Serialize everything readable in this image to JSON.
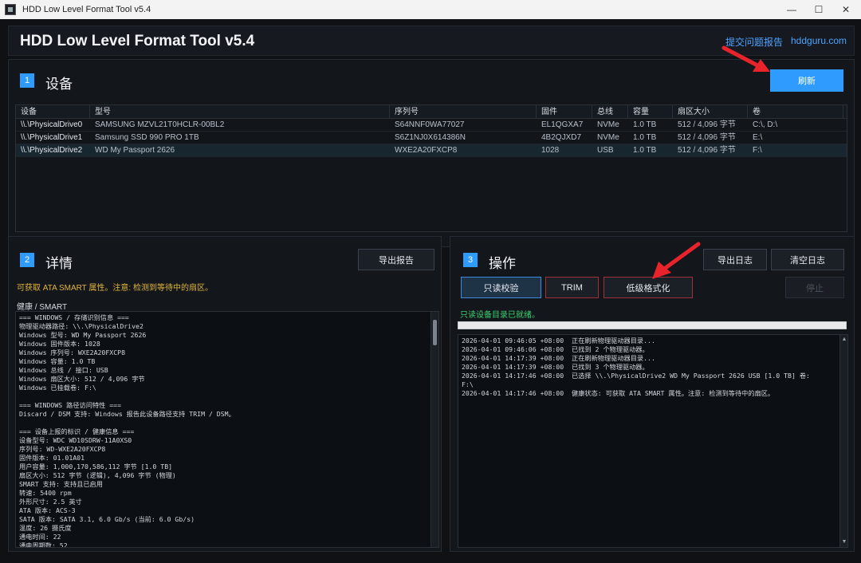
{
  "window": {
    "title": "HDD Low Level Format Tool v5.4",
    "controls": [
      "—",
      "☐",
      "✕"
    ]
  },
  "header": {
    "app_title": "HDD Low Level Format Tool v5.4",
    "links": [
      "提交问题报告",
      "hddguru.com"
    ]
  },
  "devices": {
    "step": "1",
    "title": "设备",
    "refresh_label": "刷新",
    "columns": [
      "设备",
      "型号",
      "序列号",
      "固件",
      "总线",
      "容量",
      "扇区大小",
      "卷"
    ],
    "rows": [
      [
        "\\\\.\\PhysicalDrive0",
        "SAMSUNG MZVL21T0HCLR-00BL2",
        "S64NNF0WA77027",
        "EL1QGXA7",
        "NVMe",
        "1.0 TB",
        "512 / 4,096 字节",
        "C:\\, D:\\"
      ],
      [
        "\\\\.\\PhysicalDrive1",
        "Samsung SSD 990 PRO 1TB",
        "S6Z1NJ0X614386N",
        "4B2QJXD7",
        "NVMe",
        "1.0 TB",
        "512 / 4,096 字节",
        "E:\\"
      ],
      [
        "\\\\.\\PhysicalDrive2",
        "WD My Passport 2626",
        "WXE2A20FXCP8",
        "1028",
        "USB",
        "1.0 TB",
        "512 / 4,096 字节",
        "F:\\"
      ]
    ],
    "selected_row": 2
  },
  "details": {
    "step": "2",
    "title": "详情",
    "export_label": "导出报告",
    "warning": "可获取 ATA SMART 属性。注意: 检测到等待中的扇区。",
    "section_label": "健康 / SMART",
    "text": "=== WINDOWS / 存储识别信息 ===\n物理驱动器路径: \\\\.\\PhysicalDrive2\nWindows 型号: WD My Passport 2626\nWindows 固件版本: 1028\nWindows 序列号: WXE2A20FXCP8\nWindows 容量: 1.0 TB\nWindows 总线 / 接口: USB\nWindows 扇区大小: 512 / 4,096 字节\nWindows 已挂载卷: F:\\\n\n=== WINDOWS 路径访问特性 ===\nDiscard / DSM 支持: Windows 报告此设备路径支持 TRIM / DSM。\n\n=== 设备上报的标识 / 健康信息 ===\n设备型号: WDC WD10SDRW-11A0XS0\n序列号: WD-WXE2A20FXCP8\n固件版本: 01.01A01\n用户容量: 1,000,170,586,112 字节 [1.0 TB]\n扇区大小: 512 字节 (逻辑), 4,096 字节 (物理)\nSMART 支持: 支持且已启用\n转速: 5400 rpm\n外形尺寸: 2.5 英寸\nATA 版本: ACS-3\nSATA 版本: SATA 3.1, 6.0 Gb/s (当前: 6.0 Gb/s)\n温度: 26 摄氏度\n通电时间: 22\n通电周期数: 52"
  },
  "operations": {
    "step": "3",
    "title": "操作",
    "export_log_label": "导出日志",
    "clear_log_label": "清空日志",
    "verify_label": "只读校验",
    "trim_label": "TRIM",
    "lowlevel_label": "低级格式化",
    "stop_label": "停止",
    "status": "只读设备目录已就绪。",
    "progress": 0,
    "log": "2026-04-01 09:46:05 +08:00  正在刷新物理驱动器目录...\n2026-04-01 09:46:06 +08:00  已找到 2 个物理驱动器。\n2026-04-01 14:17:39 +08:00  正在刷新物理驱动器目录...\n2026-04-01 14:17:39 +08:00  已找到 3 个物理驱动器。\n2026-04-01 14:17:46 +08:00  已选择 \\\\.\\PhysicalDrive2 WD My Passport 2626 USB [1.0 TB] 卷:\nF:\\\n2026-04-01 14:17:46 +08:00  健康状态: 可获取 ATA SMART 属性。注意: 检测到等待中的扇区。"
  },
  "colors": {
    "accent": "#2f9bff",
    "warning": "#e0b33b",
    "ok": "#3ccf6e",
    "annotation_arrow": "#e8232a"
  }
}
